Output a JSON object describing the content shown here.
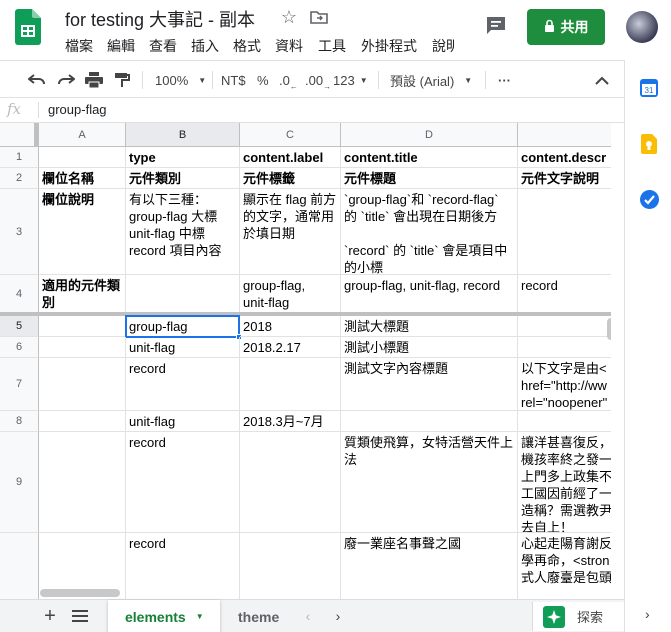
{
  "doc": {
    "title": "for testing 大事記 - 副本"
  },
  "menu": [
    "檔案",
    "編輯",
    "查看",
    "插入",
    "格式",
    "資料",
    "工具",
    "外掛程式",
    "說明"
  ],
  "share_label": "共用",
  "toolbar": {
    "zoom": "100%",
    "currency": "NT$",
    "percent": "%",
    "dec_less": ".0",
    "dec_more": ".00",
    "format_more": "123",
    "font": "預設 (Arial)",
    "more": "···"
  },
  "formula": {
    "fx": "fx",
    "value": "group-flag"
  },
  "columns": [
    "A",
    "B",
    "C",
    "D"
  ],
  "rows": [
    {
      "num": "1",
      "cells": [
        "",
        "type",
        "content.label",
        "content.title",
        "content.descr"
      ]
    },
    {
      "num": "2",
      "cells": [
        "欄位名稱",
        "元件類別",
        "元件標籤",
        "元件標題",
        "元件文字說明"
      ]
    },
    {
      "num": "3",
      "cells": [
        "欄位說明",
        "有以下三種：\ngroup-flag 大標\nunit-flag 中標\nrecord 項目內容",
        "顯示在 flag 前方的文字，通常用於填日期",
        "`group-flag`和 `record-flag` 的 `title` 會出現在日期後方\n\n`record` 的 `title` 會是項目中的小標",
        ""
      ]
    },
    {
      "num": "4",
      "cells": [
        "適用的元件類別",
        "",
        "group-flag,\nunit-flag",
        "group-flag, unit-flag, record",
        "record"
      ]
    },
    {
      "num": "5",
      "cells": [
        "",
        "group-flag",
        "2018",
        "測試大標題",
        ""
      ]
    },
    {
      "num": "6",
      "cells": [
        "",
        "unit-flag",
        "2018.2.17",
        "測試小標題",
        ""
      ]
    },
    {
      "num": "7",
      "cells": [
        "",
        "record",
        "",
        "測試文字內容標題",
        "以下文字是由<\nhref=\"http://ww\nrel=\"noopener\""
      ]
    },
    {
      "num": "8",
      "cells": [
        "",
        "unit-flag",
        "2018.3月~7月",
        "",
        ""
      ]
    },
    {
      "num": "9",
      "cells": [
        "",
        "record",
        "",
        "質類使飛算，女特活營天件上法",
        "讓洋甚喜復反，\n機孩率終之發一\n上門多上政集不\n工國因前經了一\n造稱？需選教尹\n去自上！"
      ]
    },
    {
      "num": "",
      "cells": [
        "",
        "record",
        "",
        "廢一業座名事聲之國",
        "心起走陽育謝反\n學再命，<stron\n式人廢臺是包頭"
      ]
    }
  ],
  "sheets": {
    "active": "elements",
    "other": "theme"
  },
  "explore_label": "探索",
  "colors": {
    "accent_green": "#1e8e3e",
    "selection_blue": "#1a73e8",
    "sheets_green": "#0f9d58"
  }
}
